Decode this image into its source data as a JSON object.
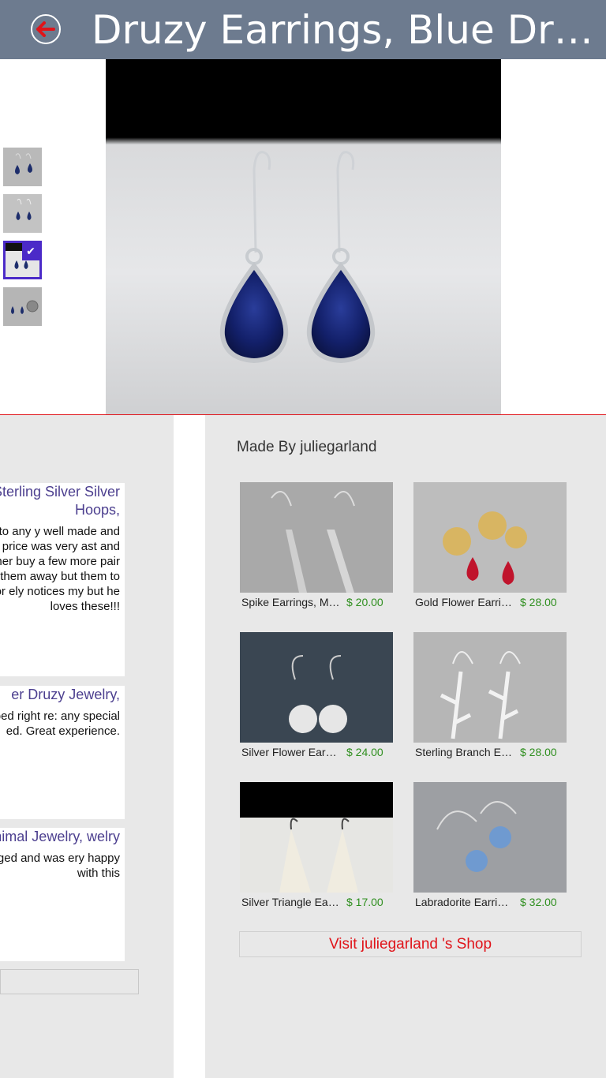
{
  "header": {
    "title": "Druzy Earrings, Blue Druzy Earrings, Sterling Silver"
  },
  "thumbnails": [
    {
      "alt": "earrings-thumb-1",
      "selected": false
    },
    {
      "alt": "earrings-thumb-2",
      "selected": false
    },
    {
      "alt": "earrings-thumb-3",
      "selected": true
    },
    {
      "alt": "earrings-thumb-4",
      "selected": false
    }
  ],
  "reviews": [
    {
      "title": "s, Sterling Silver Silver Hoops,",
      "body": "flattering to any y well made and The price was very ast and customer buy a few more pair give them away but them to myself for ely notices my but he loves these!!!"
    },
    {
      "title": "er Druzy Jewelry,",
      "body": "ey shipped right re: any special ed. Great experience."
    },
    {
      "title": "Minimal Jewelry, welry",
      "body": "ully packaged and was ery happy with this"
    }
  ],
  "shop": {
    "made_by_label": "Made By  juliegarland",
    "visit_label": "Visit  juliegarland 's Shop"
  },
  "items": [
    {
      "name": "Spike Earrings, Modern Earrings",
      "price": "$ 20.00"
    },
    {
      "name": "Gold Flower Earrings",
      "price": "$ 28.00"
    },
    {
      "name": "Silver Flower Earrings",
      "price": "$ 24.00"
    },
    {
      "name": "Sterling Branch Earrings",
      "price": "$ 28.00"
    },
    {
      "name": "Silver Triangle Earrings",
      "price": "$ 17.00"
    },
    {
      "name": "Labradorite Earrings",
      "price": "$ 32.00"
    }
  ],
  "colors": {
    "header": "#6d7b8f",
    "accent_red": "#e0141a",
    "price_green": "#2f8f1f",
    "review_title": "#4c3f8f",
    "selected_thumb": "#4b2ac8"
  },
  "icons": {
    "back": "arrow-left-circle-icon",
    "selected": "checkmark-icon"
  }
}
